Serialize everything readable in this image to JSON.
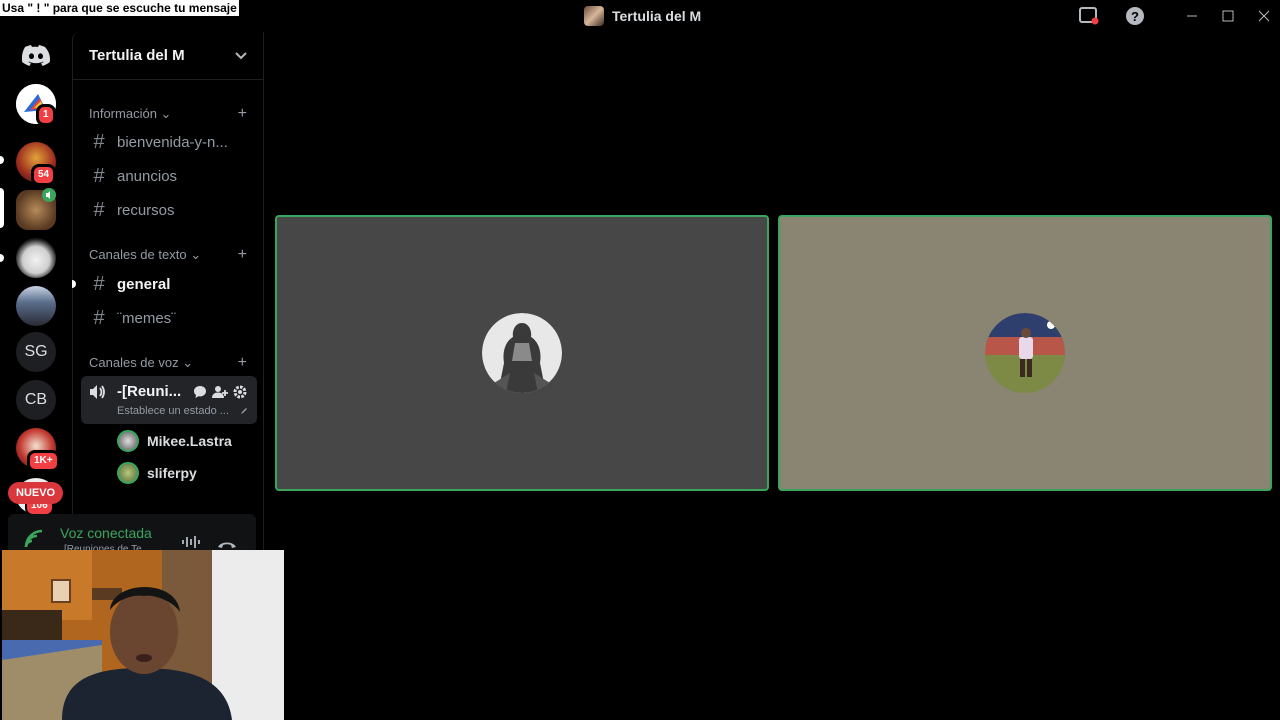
{
  "overlay": {
    "message": "Usa \" ! \" para que se escuche tu mensaje"
  },
  "window": {
    "title": "Tertulia del M"
  },
  "rail": {
    "dm_badge": "1",
    "server_badges": {
      "s1": "54",
      "s6": "1K+",
      "s7": "106"
    },
    "initials": {
      "sg": "SG",
      "cb": "CB"
    },
    "new_label": "NUEVO"
  },
  "guild": {
    "name": "Tertulia del M"
  },
  "categories": {
    "info": "Información",
    "text": "Canales de texto",
    "voice": "Canales de voz"
  },
  "channels": {
    "bienvenida": "bienvenida-y-n...",
    "anuncios": "anuncios",
    "recursos": "recursos",
    "general": "general",
    "memes": "¨memes¨"
  },
  "voice_channel": {
    "name": "-[Reuni...",
    "status_placeholder": "Establece un estado ...",
    "users": [
      "Mikee.Lastra",
      "sliferpy"
    ]
  },
  "voice_panel": {
    "status": "Voz conectada",
    "sub": "[Reuniones de Te..."
  },
  "colors": {
    "accent_green": "#3ba55d",
    "badge_red": "#f23f43",
    "tile1_bg": "#474747",
    "tile2_bg": "#8a8572"
  }
}
